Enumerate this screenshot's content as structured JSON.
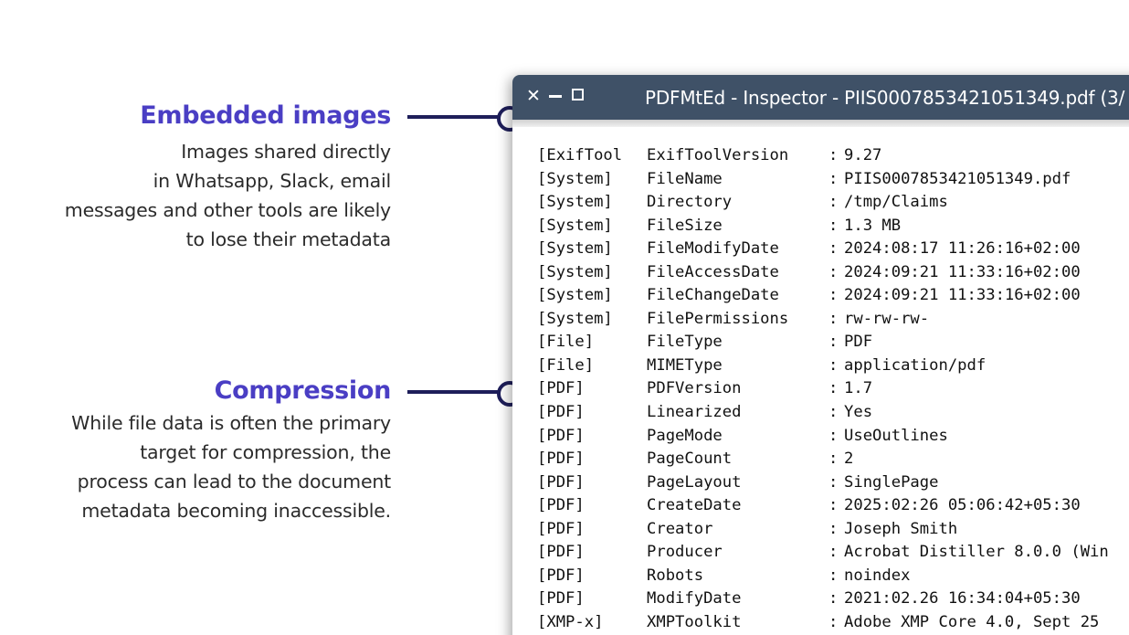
{
  "annotations": {
    "embedded": {
      "title": "Embedded images",
      "description": "Images shared directly\nin Whatsapp, Slack, email\nmessages and other tools are likely\nto lose their metadata"
    },
    "compression": {
      "title": "Compression",
      "description": "While file data is often the primary\ntarget for compression, the\nprocess can lead to the document\nmetadata becoming inaccessible."
    }
  },
  "window": {
    "title": "PDFMtEd - Inspector - PIIS0007853421051349.pdf (3/",
    "controls": {
      "close": "✕",
      "minimize": "minimize-icon",
      "maximize": "maximize-icon"
    }
  },
  "metadata": [
    {
      "group": "[ExifTool",
      "tag": "ExifToolVersion",
      "value": "9.27"
    },
    {
      "group": "[System]",
      "tag": "FileName",
      "value": "PIIS0007853421051349.pdf"
    },
    {
      "group": "[System]",
      "tag": "Directory",
      "value": "/tmp/Claims"
    },
    {
      "group": "[System]",
      "tag": "FileSize",
      "value": "1.3 MB"
    },
    {
      "group": "[System]",
      "tag": "FileModifyDate",
      "value": "2024:08:17 11:26:16+02:00"
    },
    {
      "group": "[System]",
      "tag": "FileAccessDate",
      "value": "2024:09:21 11:33:16+02:00"
    },
    {
      "group": "[System]",
      "tag": "FileChangeDate",
      "value": "2024:09:21 11:33:16+02:00"
    },
    {
      "group": "[System]",
      "tag": "FilePermissions",
      "value": "rw-rw-rw-"
    },
    {
      "group": "[File]",
      "tag": "FileType",
      "value": "PDF"
    },
    {
      "group": "[File]",
      "tag": "MIMEType",
      "value": "application/pdf"
    },
    {
      "group": "[PDF]",
      "tag": "PDFVersion",
      "value": "1.7"
    },
    {
      "group": "[PDF]",
      "tag": "Linearized",
      "value": "Yes"
    },
    {
      "group": "[PDF]",
      "tag": "PageMode",
      "value": "UseOutlines"
    },
    {
      "group": "[PDF]",
      "tag": "PageCount",
      "value": "2"
    },
    {
      "group": "[PDF]",
      "tag": "PageLayout",
      "value": "SinglePage"
    },
    {
      "group": "[PDF]",
      "tag": "CreateDate",
      "value": "2025:02:26 05:06:42+05:30"
    },
    {
      "group": "[PDF]",
      "tag": "Creator",
      "value": "Joseph Smith"
    },
    {
      "group": "[PDF]",
      "tag": "Producer",
      "value": "Acrobat Distiller 8.0.0 (Win"
    },
    {
      "group": "[PDF]",
      "tag": "Robots",
      "value": "noindex"
    },
    {
      "group": "[PDF]",
      "tag": "ModifyDate",
      "value": "2021:02.26 16:34:04+05:30"
    },
    {
      "group": "[XMP-x]",
      "tag": "XMPToolkit",
      "value": "Adobe XMP Core 4.0, Sept 25"
    }
  ],
  "colors": {
    "accent": "#4a3ec4",
    "connector": "#1e1e5a",
    "titlebar": "#3f5167"
  }
}
